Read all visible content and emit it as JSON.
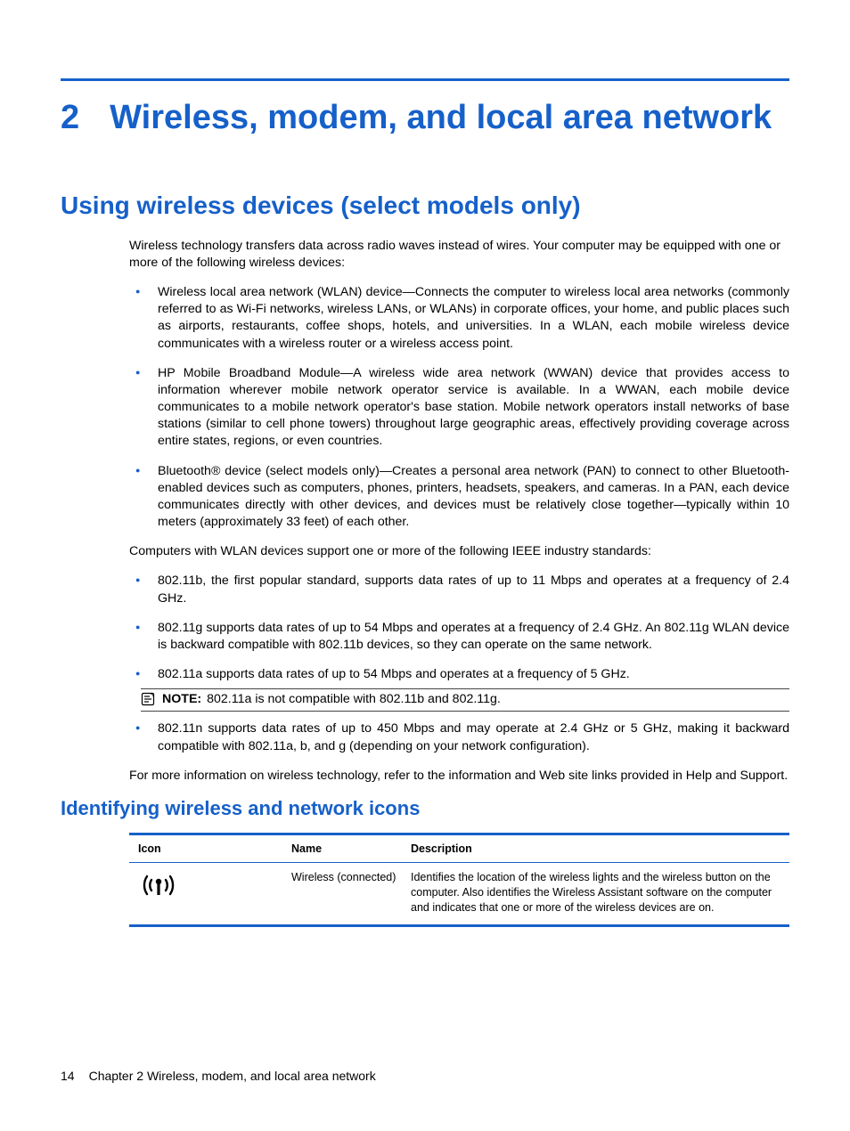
{
  "chapter": {
    "number": "2",
    "title": "Wireless, modem, and local area network"
  },
  "section": {
    "title": "Using wireless devices (select models only)",
    "intro": "Wireless technology transfers data across radio waves instead of wires. Your computer may be equipped with one or more of the following wireless devices:",
    "devices": [
      "Wireless local area network (WLAN) device—Connects the computer to wireless local area networks (commonly referred to as Wi-Fi networks, wireless LANs, or WLANs) in corporate offices, your home, and public places such as airports, restaurants, coffee shops, hotels, and universities. In a WLAN, each mobile wireless device communicates with a wireless router or a wireless access point.",
      "HP Mobile Broadband Module—A wireless wide area network (WWAN) device that provides access to information wherever mobile network operator service is available. In a WWAN, each mobile device communicates to a mobile network operator's base station. Mobile network operators install networks of base stations (similar to cell phone towers) throughout large geographic areas, effectively providing coverage across entire states, regions, or even countries.",
      "Bluetooth® device (select models only)—Creates a personal area network (PAN) to connect to other Bluetooth-enabled devices such as computers, phones, printers, headsets, speakers, and cameras. In a PAN, each device communicates directly with other devices, and devices must be relatively close together—typically within 10 meters (approximately 33 feet) of each other."
    ],
    "standards_intro": "Computers with WLAN devices support one or more of the following IEEE industry standards:",
    "standards_first": [
      "802.11b, the first popular standard, supports data rates of up to 11 Mbps and operates at a frequency of 2.4 GHz.",
      "802.11g supports data rates of up to 54 Mbps and operates at a frequency of 2.4 GHz. An 802.11g WLAN device is backward compatible with 802.11b devices, so they can operate on the same network.",
      "802.11a supports data rates of up to 54 Mbps and operates at a frequency of 5 GHz."
    ],
    "note_label": "NOTE:",
    "note_text": "802.11a is not compatible with 802.11b and 802.11g.",
    "standards_rest": [
      "802.11n supports data rates of up to 450 Mbps and may operate at 2.4 GHz or 5 GHz, making it backward compatible with 802.11a, b, and g (depending on your network configuration)."
    ],
    "outro": "For more information on wireless technology, refer to the information and Web site links provided in Help and Support."
  },
  "subsection": {
    "title": "Identifying wireless and network icons",
    "head": {
      "icon": "Icon",
      "name": "Name",
      "desc": "Description"
    },
    "rows": [
      {
        "name": "Wireless (connected)",
        "desc": "Identifies the location of the wireless lights and the wireless button on the computer. Also identifies the Wireless Assistant software on the computer and indicates that one or more of the wireless devices are on."
      }
    ]
  },
  "footer": {
    "page": "14",
    "text": "Chapter 2   Wireless, modem, and local area network"
  }
}
